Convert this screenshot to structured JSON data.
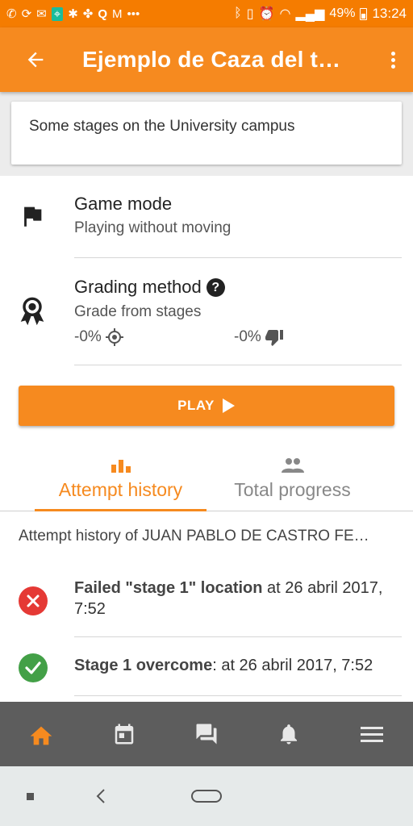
{
  "status_bar": {
    "battery": "49%",
    "time": "13:24"
  },
  "app_bar": {
    "title": "Ejemplo de Caza del t…"
  },
  "description": "Some stages on the University campus",
  "game_mode": {
    "title": "Game mode",
    "value": "Playing without moving"
  },
  "grading": {
    "title": "Grading method",
    "value": "Grade from stages",
    "location_penalty": "-0%",
    "fail_penalty": "-0%"
  },
  "play_button": {
    "label": "PLAY"
  },
  "tabs": [
    {
      "label": "Attempt history",
      "icon": "bar-chart-icon",
      "active": true
    },
    {
      "label": "Total progress",
      "icon": "people-icon",
      "active": false
    }
  ],
  "history": {
    "header": "Attempt history of JUAN PABLO DE CASTRO FE…",
    "items": [
      {
        "status": "fail",
        "bold": "Failed \"stage 1\" location",
        "rest": " at 26 abril 2017, 7:52"
      },
      {
        "status": "ok",
        "bold": "Stage 1 overcome",
        "rest": ": at 26 abril 2017, 7:52"
      }
    ]
  },
  "bottom_nav": [
    "home-icon",
    "calendar-icon",
    "messages-icon",
    "notifications-icon",
    "menu-icon"
  ],
  "colors": {
    "accent": "#f68a1f",
    "fail": "#e53935",
    "success": "#43a047",
    "nav_bg": "#5d5d5d"
  }
}
